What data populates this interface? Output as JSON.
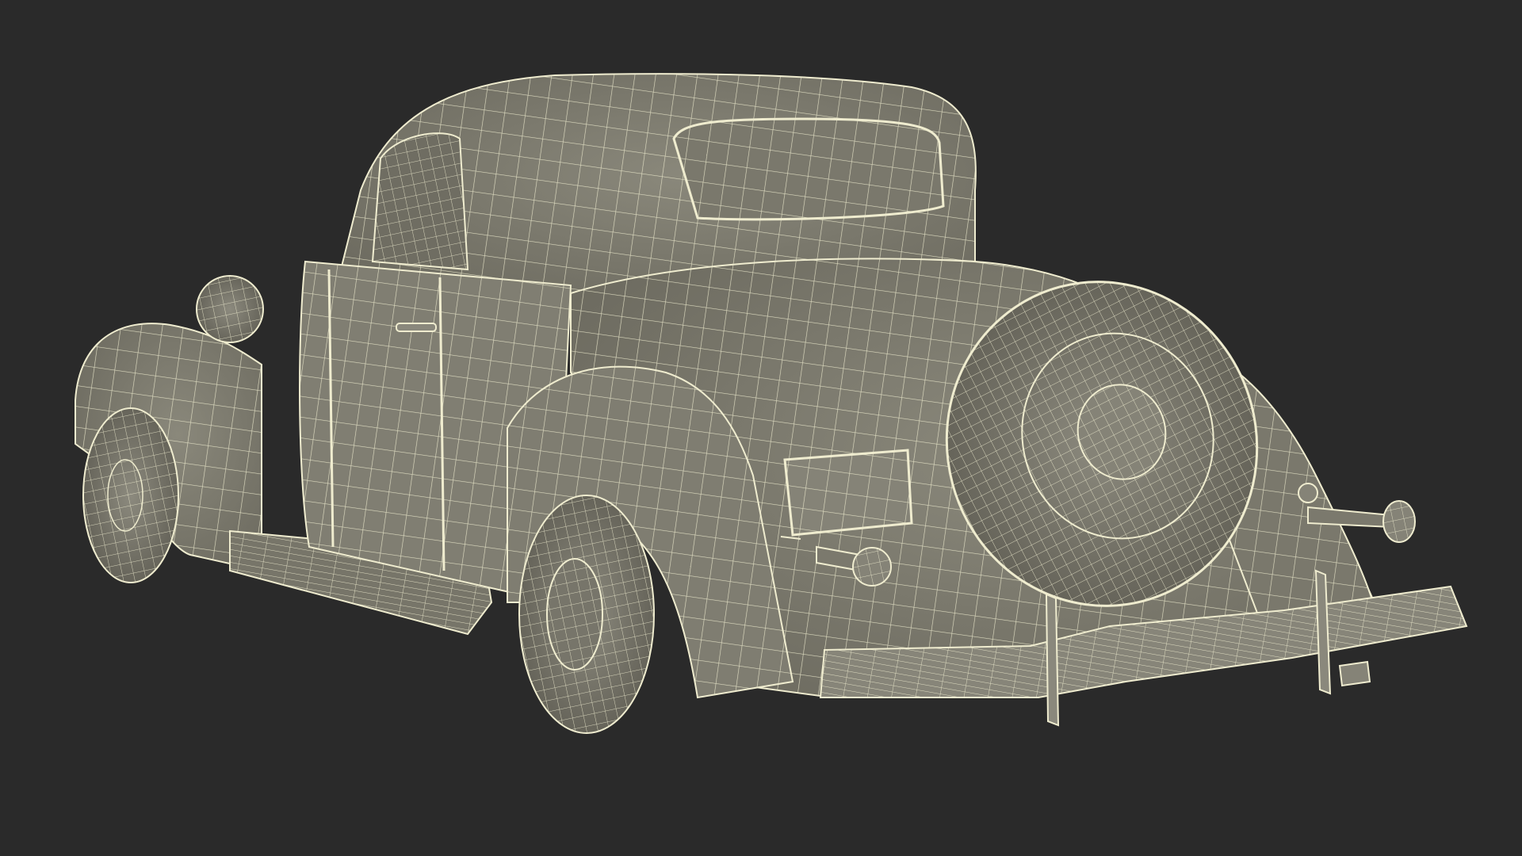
{
  "scene": {
    "background_color": "#2a2a2a",
    "surface_color": "#7d7b6f",
    "surface_shadow_color": "#5d5c52",
    "wire_color": "#efeccf",
    "subject": "vintage-coupe-wireframe"
  }
}
